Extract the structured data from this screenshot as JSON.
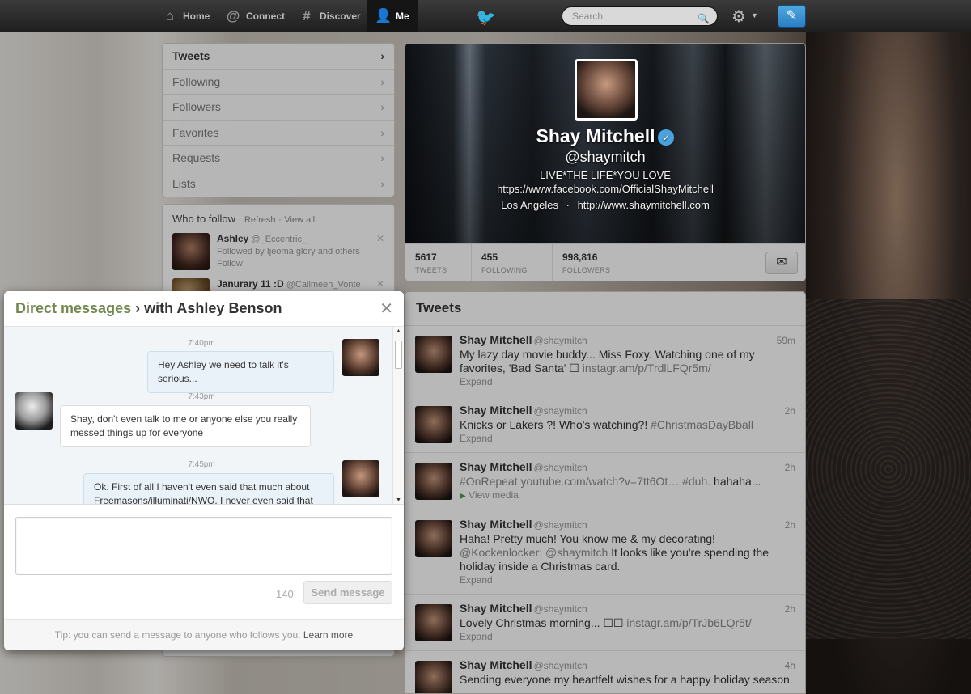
{
  "nav": {
    "home": "Home",
    "connect": "Connect",
    "discover": "Discover",
    "me": "Me",
    "search_placeholder": "Search"
  },
  "sidebar": {
    "items": [
      {
        "label": "Tweets"
      },
      {
        "label": "Following"
      },
      {
        "label": "Followers"
      },
      {
        "label": "Favorites"
      },
      {
        "label": "Requests"
      },
      {
        "label": "Lists"
      }
    ]
  },
  "who_to_follow": {
    "title": "Who to follow",
    "refresh": "Refresh",
    "view_all": "View all",
    "separator": "·",
    "users": [
      {
        "name": "Ashley",
        "handle": "@_Eccentric_",
        "note": "Followed by Ijeoma glory and others",
        "action": "Follow"
      },
      {
        "name": "Janurary 11 :D",
        "handle": "@Callmeeh_Vonte"
      }
    ]
  },
  "profile": {
    "name": "Shay Mitchell",
    "handle": "@shaymitch",
    "bio": "LIVE*THE LIFE*YOU LOVE",
    "facebook": "https://www.facebook.com/OfficialShayMitchell",
    "location": "Los Angeles",
    "separator": "·",
    "website": "http://www.shaymitchell.com",
    "stats": {
      "tweets": {
        "value": "5617",
        "label": "TWEETS"
      },
      "following": {
        "value": "455",
        "label": "FOLLOWING"
      },
      "followers": {
        "value": "998,816",
        "label": "FOLLOWERS"
      }
    }
  },
  "stream": {
    "title": "Tweets",
    "tweets": [
      {
        "name": "Shay Mitchell",
        "handle": "@shaymitch",
        "time": "59m",
        "text": "My lazy day movie buddy... Miss Foxy. Watching one of my favorites, 'Bad Santa' ☐ ",
        "link": "instagr.am/p/TrdlLFQr5m/",
        "action": "Expand"
      },
      {
        "name": "Shay Mitchell",
        "handle": "@shaymitch",
        "time": "2h",
        "text": "Knicks or Lakers ?! Who's watching?! ",
        "tag": "#ChristmasDayBball",
        "action": "Expand"
      },
      {
        "name": "Shay Mitchell",
        "handle": "@shaymitch",
        "time": "2h",
        "tag": "#OnRepeat",
        "link": " youtube.com/watch?v=7tt6Ot… ",
        "tag2": "#duh.",
        "text": " hahaha...",
        "action": "View media"
      },
      {
        "name": "Shay Mitchell",
        "handle": "@shaymitch",
        "time": "2h",
        "text": "Haha! Pretty much! You know me & my decorating! ",
        "link": "@Kockenlocker: @shaymitch",
        "text2": " It looks like you're spending the holiday inside a Christmas card.",
        "action": "Expand"
      },
      {
        "name": "Shay Mitchell",
        "handle": "@shaymitch",
        "time": "2h",
        "text": "Lovely Christmas morning... ☐☐ ",
        "link": "instagr.am/p/TrJb6LQr5t/",
        "action": "Expand"
      },
      {
        "name": "Shay Mitchell",
        "handle": "@shaymitch",
        "time": "4h",
        "text": "Sending everyone my heartfelt wishes for a happy holiday season."
      }
    ]
  },
  "dm": {
    "title_link": "Direct messages",
    "title_rest": " › with Ashley Benson",
    "messages": [
      {
        "time": "7:40pm",
        "text": "Hey Ashley we need to talk it's serious..."
      },
      {
        "time": "7:43pm",
        "text": "Shay, don't even talk to me or anyone else you really messed things up for everyone"
      },
      {
        "time": "7:45pm",
        "text": "Ok. First of all I haven't even said that much about Freemasons/illuminati/NWO. I never even said that"
      }
    ],
    "char_count": "140",
    "send_label": "Send message",
    "tip": "Tip: you can send a message to anyone who follows you. ",
    "learn_more": "Learn more"
  }
}
